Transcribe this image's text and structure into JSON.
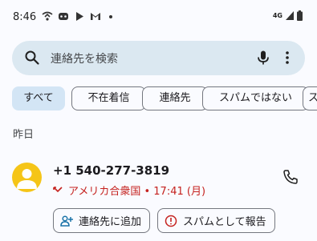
{
  "status_bar": {
    "time": "8:46",
    "network": "4G",
    "icons_left": [
      "wifi-calling-icon",
      "voicemail-app-icon",
      "play-store-icon",
      "gmail-icon"
    ],
    "icons_right": [
      "signal-icon",
      "battery-icon"
    ]
  },
  "search": {
    "placeholder": "連絡先を検索",
    "icons": [
      "search-icon",
      "mic-icon",
      "more-vert-icon"
    ]
  },
  "filters": {
    "selected": "すべて",
    "items": [
      {
        "label": "すべて"
      },
      {
        "label": "不在着信"
      },
      {
        "label": "連絡先"
      },
      {
        "label": "スパムではない"
      },
      {
        "label": "ス"
      }
    ]
  },
  "section": {
    "header": "昨日"
  },
  "call_log": {
    "entries": [
      {
        "number": "+1 540-277-3819",
        "detail": "アメリカ合衆国 • 17:41 (月)",
        "status": "missed",
        "avatar_color": "#f5c518",
        "actions": {
          "add_contact": "連絡先に追加",
          "report_spam": "スパムとして報告"
        }
      }
    ]
  },
  "colors": {
    "accent": "#d3e5f5",
    "search_bg": "#dbe8f1",
    "missed": "#c5221f",
    "avatar": "#f5c518",
    "add_contact_icon": "#1a73a8",
    "spam_icon": "#c5221f"
  }
}
